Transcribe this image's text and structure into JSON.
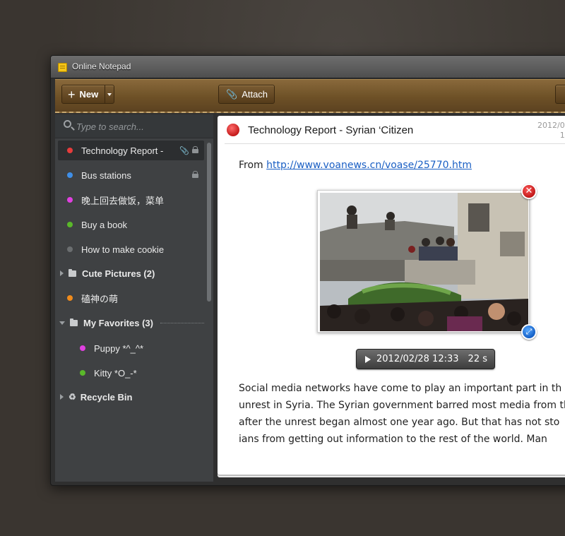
{
  "window": {
    "title": "Online Notepad"
  },
  "toolbar": {
    "new_label": "New",
    "attach_label": "Attach"
  },
  "search": {
    "placeholder": "Type to search..."
  },
  "sidebar": {
    "items": [
      {
        "label": "Technology Report -",
        "color": "#e53c3c",
        "selected": true
      },
      {
        "label": "Bus stations",
        "color": "#3f8fe8"
      },
      {
        "label": "晚上回去做饭，菜单",
        "color": "#e040e0"
      },
      {
        "label": "Buy a book",
        "color": "#5ab82a"
      },
      {
        "label": "How to make cookie",
        "color": "#6b6e70"
      }
    ],
    "folder_cute": "Cute Pictures (2)",
    "item_cn": {
      "label": "磕神の萌",
      "color": "#f08b1c"
    },
    "folder_fav": "My Favorites (3)",
    "fav_items": [
      {
        "label": "Puppy *^_^*",
        "color": "#e040e0"
      },
      {
        "label": "Kitty *O_-*",
        "color": "#5ab82a"
      }
    ],
    "recycle": "Recycle Bin"
  },
  "note": {
    "title": "Technology Report - Syrian ‘Citizen",
    "date_line1": "2012/0",
    "date_line2": "1",
    "from_label": "From",
    "link": "http://www.voanews.cn/voase/25770.htm",
    "audio_time": "2012/02/28 12:33",
    "audio_duration": "22 s",
    "body": [
      "Social media networks have come to play an important part in th",
      "unrest in Syria. The Syrian government barred most media from th",
      "after the unrest began almost one year ago. But that has not sto",
      "ians from getting out information to the rest of the world. Man"
    ]
  }
}
